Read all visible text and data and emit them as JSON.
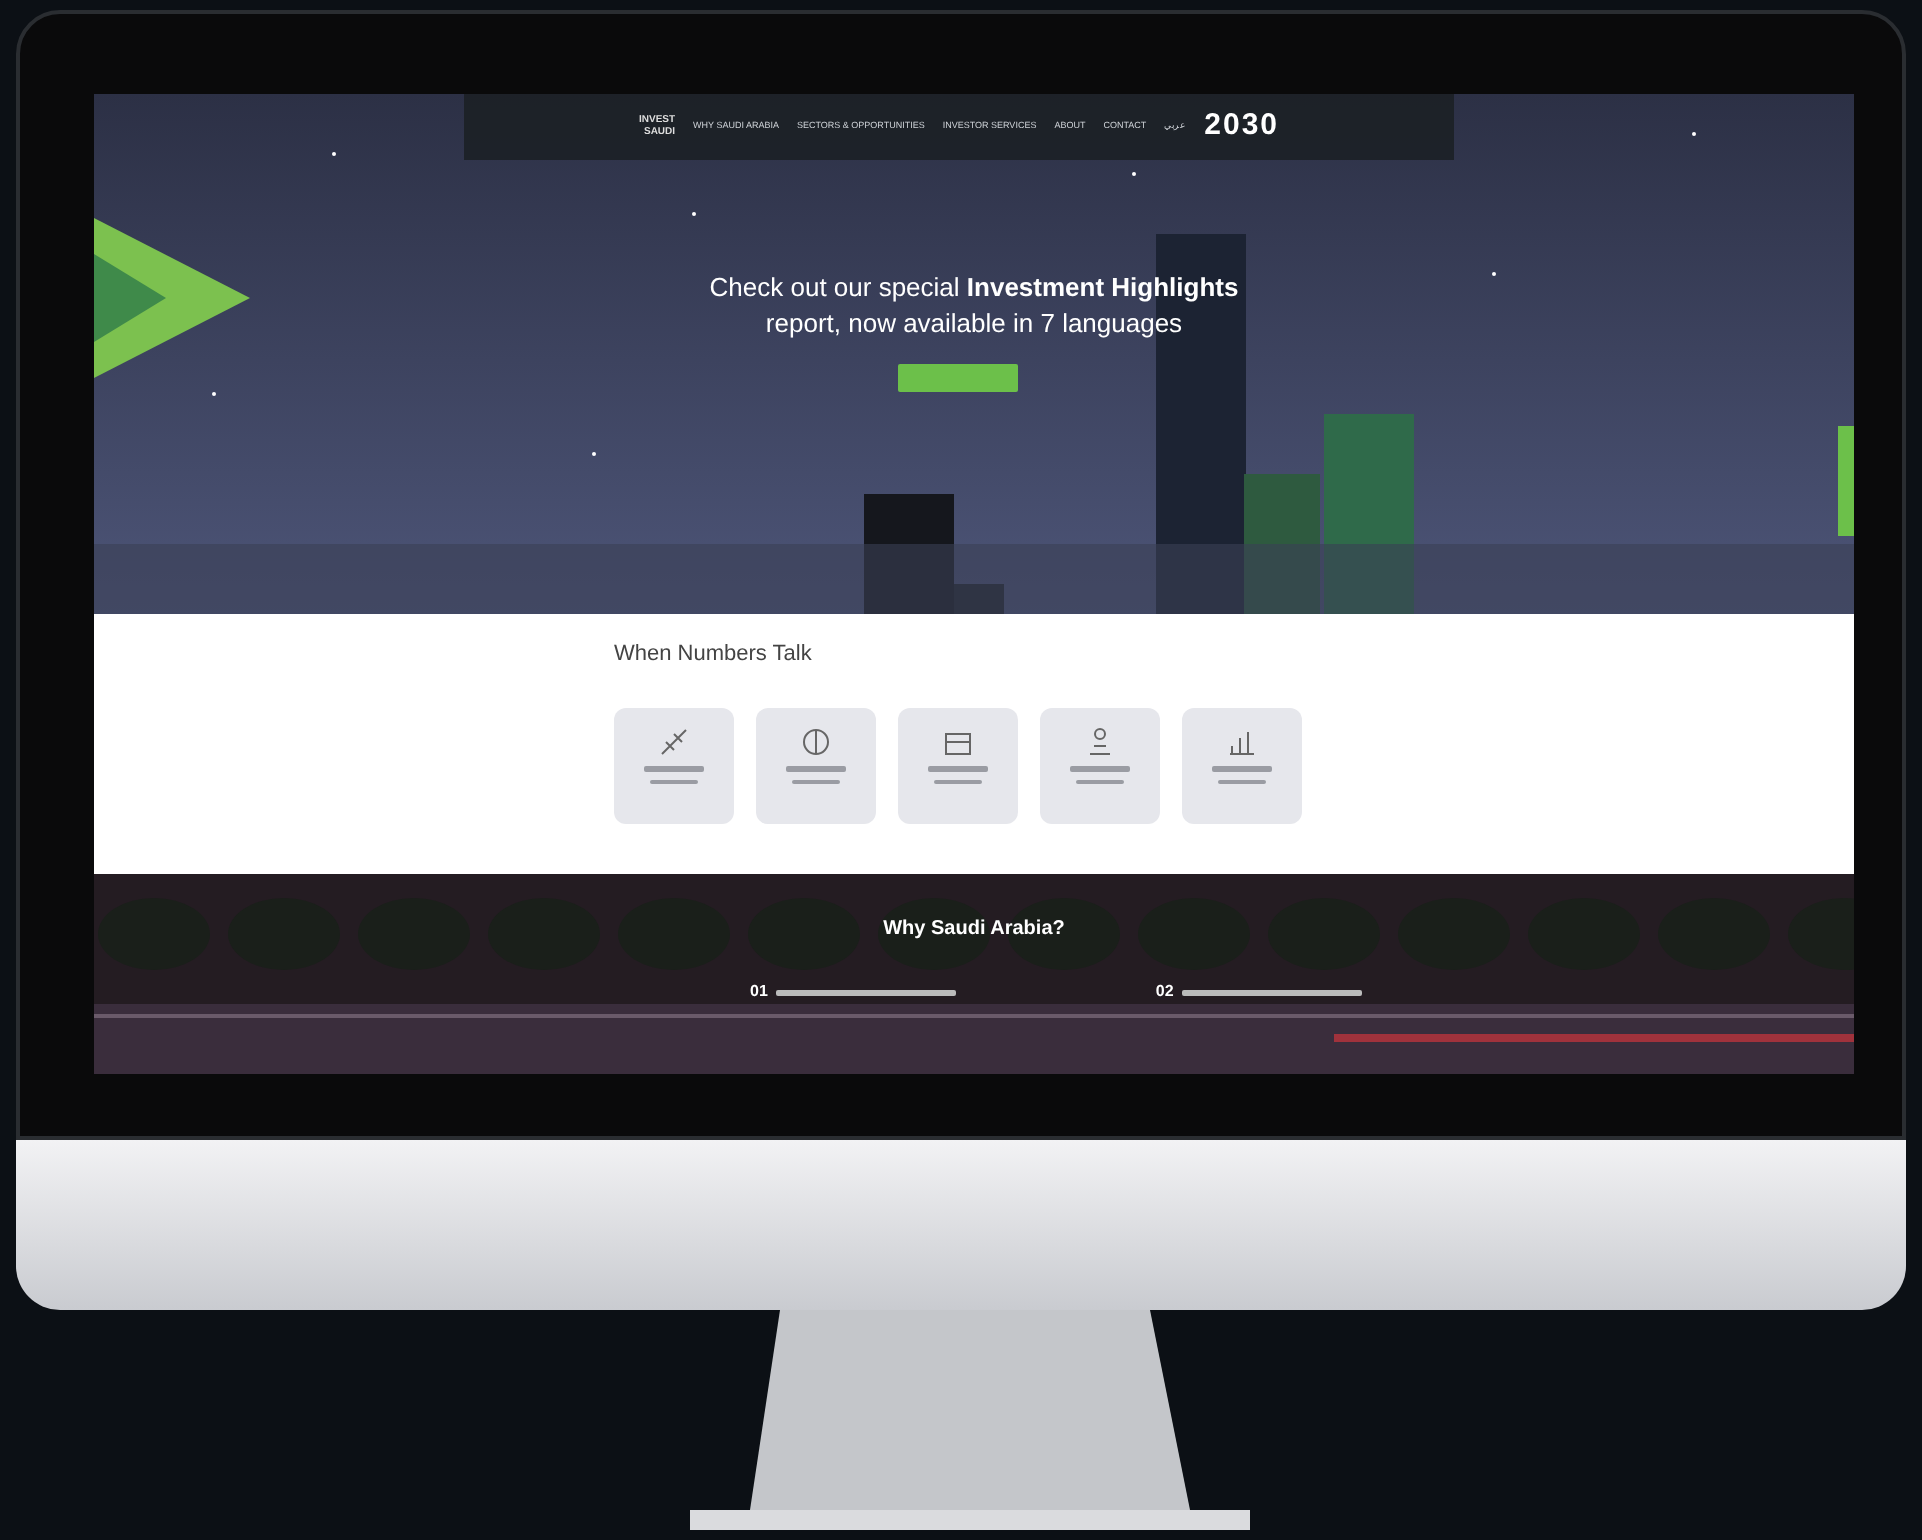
{
  "nav": {
    "logo": [
      "INVEST",
      "SAUDI"
    ],
    "items": [
      {
        "label": "WHY SAUDI ARABIA"
      },
      {
        "label": "SECTORS & OPPORTUNITIES"
      },
      {
        "label": "INVESTOR SERVICES"
      },
      {
        "label": "ABOUT"
      },
      {
        "label": "CONTACT"
      },
      {
        "label": "عربي"
      }
    ],
    "vision": "2030"
  },
  "hero": {
    "headline": "Check out our special **Investment Highlights** report, now available in 7 languages"
  },
  "numbers": {
    "title": "When Numbers Talk"
  },
  "why": {
    "title": "Why Saudi Arabia?",
    "items": [
      {
        "number": "01"
      },
      {
        "number": "02"
      }
    ]
  }
}
